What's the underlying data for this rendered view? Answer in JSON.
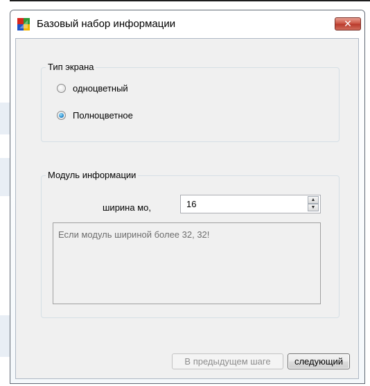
{
  "window": {
    "title": "Базовый набор информации",
    "close_label": "✕"
  },
  "screen_type": {
    "title": "Тип экрана",
    "options": [
      {
        "label": "одноцветный",
        "checked": false
      },
      {
        "label": "Полноцветное",
        "checked": true
      }
    ]
  },
  "info_module": {
    "title": "Модуль информации",
    "width_label": "ширина мо,",
    "width_value": "16",
    "hint": "Если модуль шириной более 32, 32!"
  },
  "footer": {
    "prev_label": "В предыдущем шаге",
    "next_label": "следующий"
  },
  "colors": {
    "close_button": "#c9503f",
    "radio_checked": "#1a7ec4"
  }
}
